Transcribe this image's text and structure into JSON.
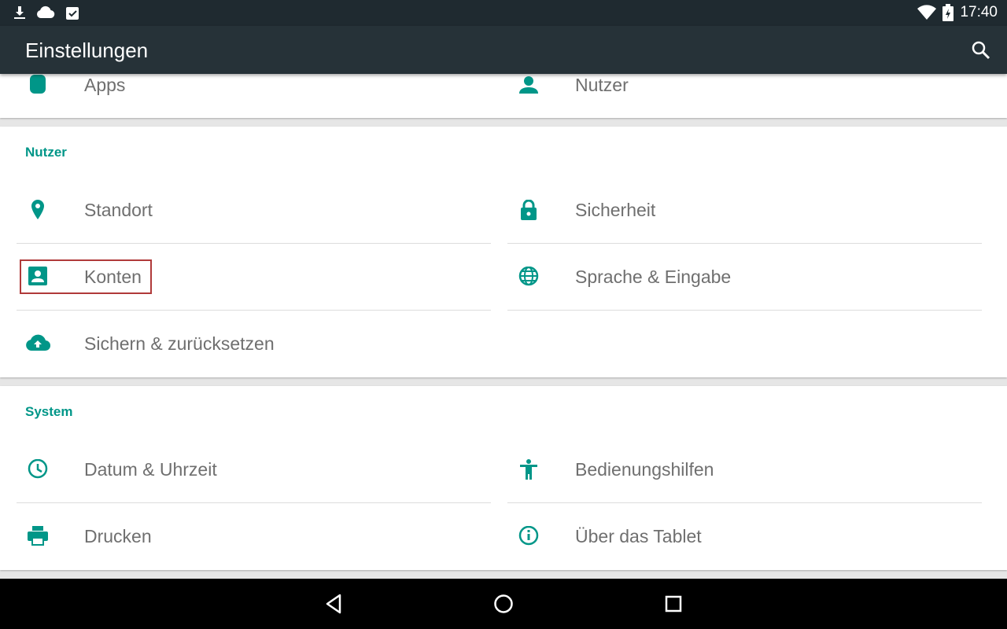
{
  "status_bar": {
    "time": "17:40"
  },
  "app_bar": {
    "title": "Einstellungen"
  },
  "top_card": {
    "left_label": "Apps",
    "right_label": "Nutzer"
  },
  "section_nutzer": {
    "header": "Nutzer",
    "items": [
      {
        "label": "Standort",
        "icon": "location-icon"
      },
      {
        "label": "Sicherheit",
        "icon": "lock-icon"
      },
      {
        "label": "Konten",
        "icon": "account-box-icon"
      },
      {
        "label": "Sprache & Eingabe",
        "icon": "globe-icon"
      },
      {
        "label": "Sichern & zurücksetzen",
        "icon": "cloud-upload-icon"
      }
    ]
  },
  "section_system": {
    "header": "System",
    "items": [
      {
        "label": "Datum & Uhrzeit",
        "icon": "clock-icon"
      },
      {
        "label": "Bedienungshilfen",
        "icon": "accessibility-icon"
      },
      {
        "label": "Drucken",
        "icon": "printer-icon"
      },
      {
        "label": "Über das Tablet",
        "icon": "info-icon"
      }
    ]
  },
  "colors": {
    "accent": "#009688",
    "appbar": "#263238",
    "statusbar": "#1f2a30",
    "highlight": "#b03a3a"
  }
}
